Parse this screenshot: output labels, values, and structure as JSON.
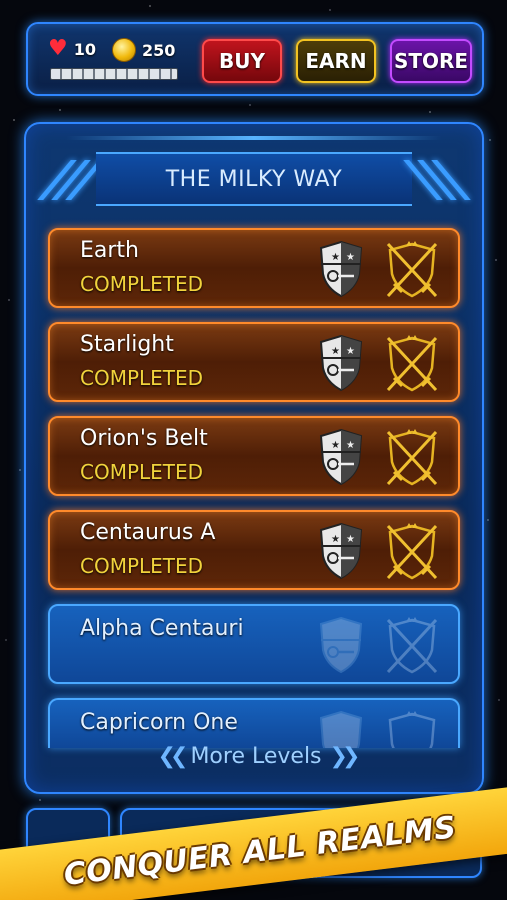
{
  "hud": {
    "lives": "10",
    "coins": "250",
    "buttons": {
      "buy": "BUY",
      "earn": "EARN",
      "store": "STORE"
    },
    "icons": {
      "lives": "heart-icon",
      "coins": "coin-icon"
    }
  },
  "panel": {
    "title": "THE MILKY WAY",
    "levels": [
      {
        "name": "Earth",
        "status": "COMPLETED",
        "state": "completed"
      },
      {
        "name": "Starlight",
        "status": "COMPLETED",
        "state": "completed"
      },
      {
        "name": "Orion's Belt",
        "status": "COMPLETED",
        "state": "completed"
      },
      {
        "name": "Centaurus A",
        "status": "COMPLETED",
        "state": "completed"
      },
      {
        "name": "Alpha Centauri",
        "status": "",
        "state": "locked"
      },
      {
        "name": "Capricorn One",
        "status": "",
        "state": "locked"
      }
    ],
    "more_levels": "More Levels"
  },
  "promo": {
    "banner": "CONQUER ALL REALMS"
  },
  "colors": {
    "completed_border": "#ff8a2b",
    "locked_border": "#4aa8ff",
    "status_text": "#f1d33c",
    "banner": "#f2a60c"
  }
}
